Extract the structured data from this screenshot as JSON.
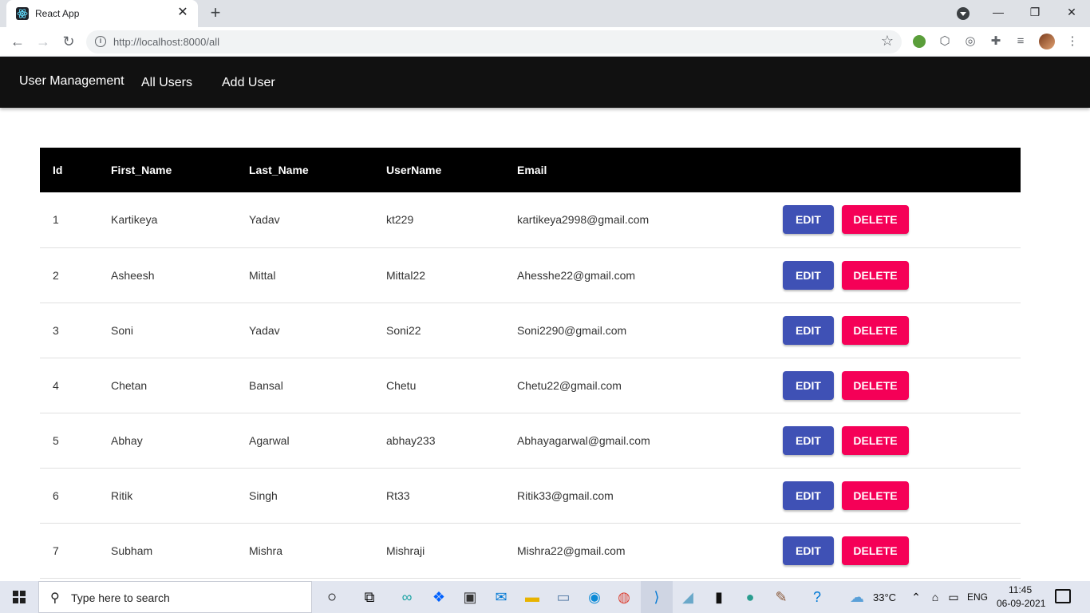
{
  "browser": {
    "tab_title": "React App",
    "url": "http://localhost:8000/all"
  },
  "appbar": {
    "brand": "User Management",
    "nav": [
      "All Users",
      "Add User"
    ]
  },
  "table": {
    "headers": [
      "Id",
      "First_Name",
      "Last_Name",
      "UserName",
      "Email"
    ],
    "rows": [
      {
        "id": "1",
        "first": "Kartikeya",
        "last": "Yadav",
        "username": "kt229",
        "email": "kartikeya2998@gmail.com"
      },
      {
        "id": "2",
        "first": "Asheesh",
        "last": "Mittal",
        "username": "Mittal22",
        "email": "Ahesshe22@gmail.com"
      },
      {
        "id": "3",
        "first": "Soni",
        "last": "Yadav",
        "username": "Soni22",
        "email": "Soni2290@gmail.com"
      },
      {
        "id": "4",
        "first": "Chetan",
        "last": "Bansal",
        "username": "Chetu",
        "email": "Chetu22@gmail.com"
      },
      {
        "id": "5",
        "first": "Abhay",
        "last": "Agarwal",
        "username": "abhay233",
        "email": "Abhayagarwal@gmail.com"
      },
      {
        "id": "6",
        "first": "Ritik",
        "last": "Singh",
        "username": "Rt33",
        "email": "Ritik33@gmail.com"
      },
      {
        "id": "7",
        "first": "Subham",
        "last": "Mishra",
        "username": "Mishraji",
        "email": "Mishra22@gmail.com"
      }
    ],
    "edit_label": "EDIT",
    "delete_label": "DELETE"
  },
  "taskbar": {
    "search_placeholder": "Type here to search",
    "weather": "33°C",
    "language": "ENG",
    "time": "11:45",
    "date": "06-09-2021"
  },
  "colors": {
    "appbar_bg": "#111111",
    "table_header_bg": "#000000",
    "edit_button": "#3f51b5",
    "delete_button": "#f50057"
  }
}
